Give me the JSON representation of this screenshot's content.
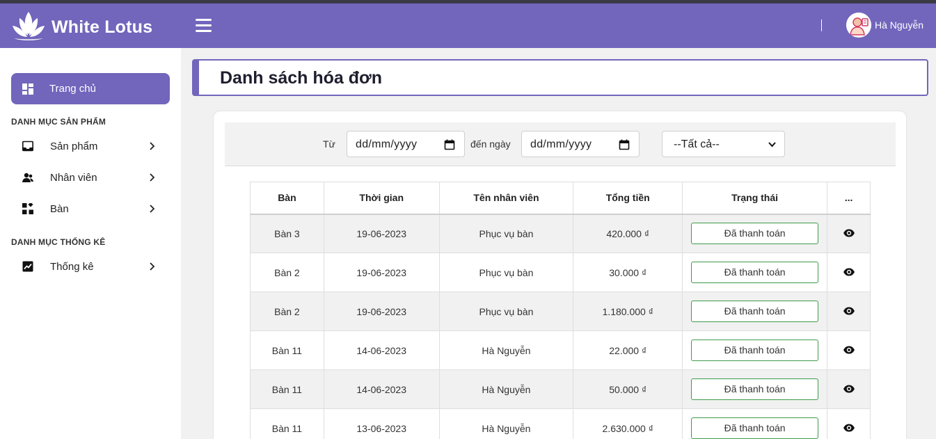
{
  "header": {
    "brand": "White Lotus",
    "user_name": "Hà Nguyễn",
    "icons": {
      "logo": "lotus-logo",
      "menu": "hamburger-icon",
      "avatar": "user-avatar"
    }
  },
  "sidebar": {
    "active_item": {
      "label": "Trang chủ",
      "icon": "dashboard-icon"
    },
    "sections": [
      {
        "title": "DANH MỤC SẢN PHẨM",
        "items": [
          {
            "label": "Sản phẩm",
            "icon": "inbox-icon"
          },
          {
            "label": "Nhân viên",
            "icon": "users-icon"
          },
          {
            "label": "Bàn",
            "icon": "grid-icon"
          }
        ]
      },
      {
        "title": "DANH MỤC THỐNG KÊ",
        "items": [
          {
            "label": "Thống kê",
            "icon": "chart-icon"
          }
        ]
      }
    ]
  },
  "page": {
    "title": "Danh sách hóa đơn"
  },
  "filters": {
    "from_label": "Từ",
    "from_value": "dd/mm/yyyy",
    "to_label": "đến ngày",
    "to_value": "dd/mm/yyyy",
    "status_selected": "--Tất cả--"
  },
  "table": {
    "headers": [
      "Bàn",
      "Thời gian",
      "Tên nhân viên",
      "Tổng tiền",
      "Trạng thái",
      "..."
    ],
    "rows": [
      {
        "table": "Bàn 3",
        "time": "19-06-2023",
        "staff": "Phục vụ bàn",
        "total": "420.000 ₫",
        "status": "Đã thanh toán"
      },
      {
        "table": "Bàn 2",
        "time": "19-06-2023",
        "staff": "Phục vụ bàn",
        "total": "30.000 ₫",
        "status": "Đã thanh toán"
      },
      {
        "table": "Bàn 2",
        "time": "19-06-2023",
        "staff": "Phục vụ bàn",
        "total": "1.180.000 ₫",
        "status": "Đã thanh toán"
      },
      {
        "table": "Bàn 11",
        "time": "14-06-2023",
        "staff": "Hà Nguyễn",
        "total": "22.000 ₫",
        "status": "Đã thanh toán"
      },
      {
        "table": "Bàn 11",
        "time": "14-06-2023",
        "staff": "Hà Nguyễn",
        "total": "50.000 ₫",
        "status": "Đã thanh toán"
      },
      {
        "table": "Bàn 11",
        "time": "13-06-2023",
        "staff": "Hà Nguyễn",
        "total": "2.630.000 ₫",
        "status": "Đã thanh toán"
      }
    ]
  },
  "colors": {
    "primary": "#7166bc",
    "status_border": "#3d9a4a",
    "stripe": "#f1f1f1"
  }
}
